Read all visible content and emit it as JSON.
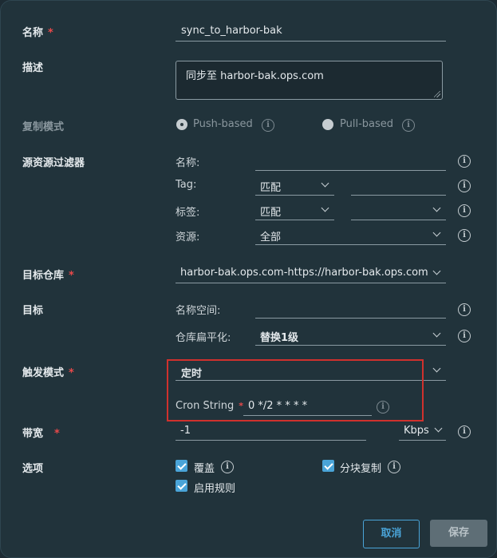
{
  "form": {
    "name": {
      "label": "名称",
      "required_mark": "*",
      "value": "sync_to_harbor-bak"
    },
    "description": {
      "label": "描述",
      "value": "同步至 harbor-bak.ops.com"
    },
    "replication_mode": {
      "label": "复制模式",
      "options": [
        {
          "label": "Push-based",
          "selected": true
        },
        {
          "label": "Pull-based",
          "selected": false
        }
      ]
    },
    "source_filter": {
      "label": "源资源过滤器",
      "name_label": "名称:",
      "tag_label": "Tag:",
      "tag_match": "匹配",
      "labels_label": "标签:",
      "labels_match": "匹配",
      "resource_label": "资源:",
      "resource_value": "全部"
    },
    "destination_registry": {
      "label": "目标仓库",
      "required_mark": "*",
      "value": "harbor-bak.ops.com-https://harbor-bak.ops.com"
    },
    "destination": {
      "label": "目标",
      "namespace_label": "名称空间:",
      "flattening_label": "仓库扁平化:",
      "flattening_value": "替换1级"
    },
    "trigger_mode": {
      "label": "触发模式",
      "required_mark": "*",
      "value": "定时",
      "cron_label": "Cron String",
      "cron_required_mark": "*",
      "cron_value": "0 */2 * * * *"
    },
    "bandwidth": {
      "label": "带宽",
      "required_mark": "*",
      "value": "-1",
      "unit": "Kbps"
    },
    "options": {
      "label": "选项",
      "items": [
        {
          "label": "覆盖",
          "checked": true
        },
        {
          "label": "分块复制",
          "checked": true
        },
        {
          "label": "启用规则",
          "checked": true
        }
      ]
    }
  },
  "footer": {
    "cancel_label": "取消",
    "save_label": "保存"
  },
  "colors": {
    "accent": "#4aa4d8",
    "required": "#e8494a",
    "highlight_box": "#d0312d"
  },
  "icons": [
    "info-icon",
    "chevron-down-icon",
    "checkmark-icon",
    "resize-grip-icon"
  ]
}
